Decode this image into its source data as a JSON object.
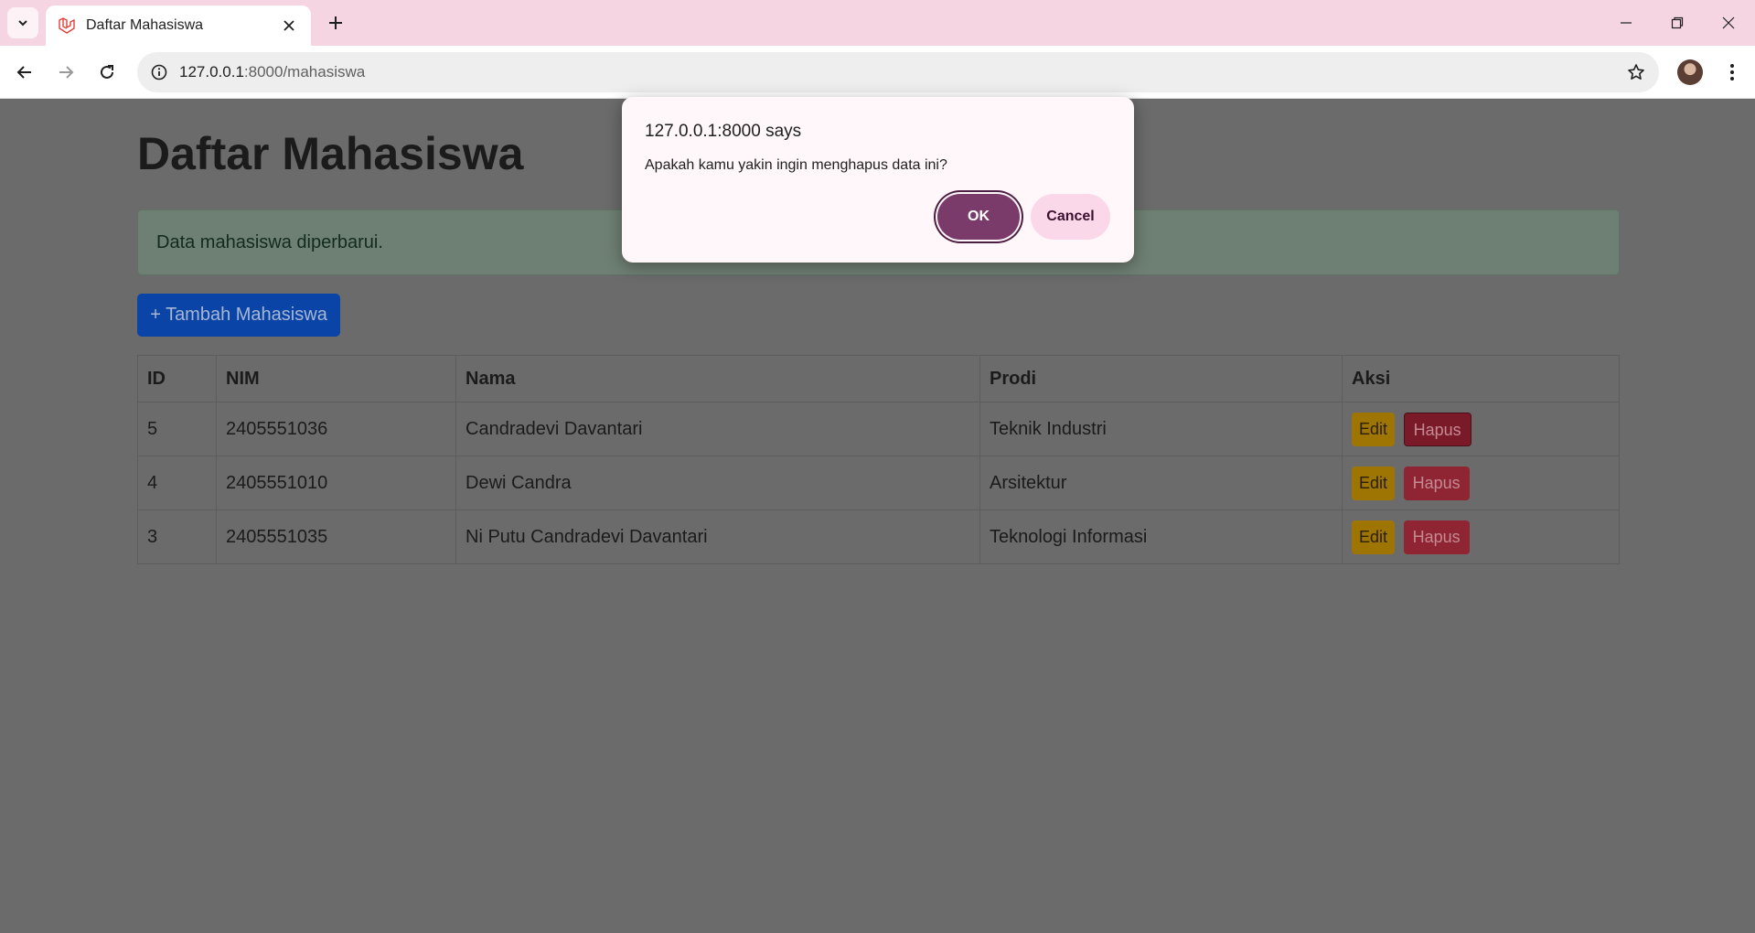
{
  "browser": {
    "tab_title": "Daftar Mahasiswa",
    "url_host": "127.0.0.1",
    "url_path": ":8000/mahasiswa"
  },
  "page": {
    "title": "Daftar Mahasiswa",
    "alert": "Data mahasiswa diperbarui.",
    "add_button": "+ Tambah Mahasiswa",
    "table": {
      "headers": [
        "ID",
        "NIM",
        "Nama",
        "Prodi",
        "Aksi"
      ],
      "rows": [
        {
          "id": "5",
          "nim": "2405551036",
          "nama": "Candradevi Davantari",
          "prodi": "Teknik Industri"
        },
        {
          "id": "4",
          "nim": "2405551010",
          "nama": "Dewi Candra",
          "prodi": "Arsitektur"
        },
        {
          "id": "3",
          "nim": "2405551035",
          "nama": "Ni Putu Candradevi Davantari",
          "prodi": "Teknologi Informasi"
        }
      ],
      "edit_label": "Edit",
      "delete_label": "Hapus"
    }
  },
  "dialog": {
    "title": "127.0.0.1:8000 says",
    "message": "Apakah kamu yakin ingin menghapus data ini?",
    "ok_label": "OK",
    "cancel_label": "Cancel"
  },
  "colors": {
    "tabstrip": "#f6d5e3",
    "dialog_ok": "#7b3b6a",
    "dialog_cancel": "#fbd8e9",
    "primary_button": "#0a44a6",
    "edit_button": "#9e7503",
    "delete_button": "#8f2433"
  }
}
